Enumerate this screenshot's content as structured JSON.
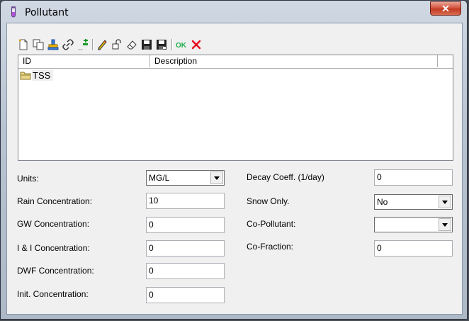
{
  "window": {
    "title": "Pollutant",
    "close_label": "✕"
  },
  "toolbar": {
    "buttons": [
      {
        "name": "new-icon"
      },
      {
        "name": "copy-icon"
      },
      {
        "name": "stamp-icon"
      },
      {
        "name": "link-icon"
      },
      {
        "name": "add-column-icon"
      },
      {
        "name": "pencil-icon"
      },
      {
        "name": "edit-lock-icon"
      },
      {
        "name": "eraser-icon"
      },
      {
        "name": "save-icon"
      },
      {
        "name": "save-as-icon"
      },
      {
        "name": "ok-icon",
        "label": "OK"
      },
      {
        "name": "cancel-icon"
      }
    ]
  },
  "grid": {
    "columns": [
      "ID",
      "Description"
    ],
    "rows": [
      {
        "id": "TSS",
        "description": ""
      }
    ]
  },
  "form": {
    "units": {
      "label": "Units:",
      "value": "MG/L"
    },
    "rain_concentration": {
      "label": "Rain Concentration:",
      "value": "10"
    },
    "gw_concentration": {
      "label": "GW Concentration:",
      "value": "0"
    },
    "ii_concentration": {
      "label": "I & I Concentration:",
      "value": "0"
    },
    "dwf_concentration": {
      "label": "DWF Concentration:",
      "value": "0"
    },
    "init_concentration": {
      "label": "Init. Concentration:",
      "value": "0"
    },
    "decay_coeff": {
      "label": "Decay Coeff. (1/day)",
      "value": "0"
    },
    "snow_only": {
      "label": "Snow Only.",
      "value": "No"
    },
    "co_pollutant": {
      "label": "Co-Pollutant:",
      "value": ""
    },
    "co_fraction": {
      "label": "Co-Fraction:",
      "value": "0"
    }
  },
  "colors": {
    "ok_green": "#22b14c",
    "cancel_red": "#e81123",
    "close_red": "#c13a22"
  }
}
